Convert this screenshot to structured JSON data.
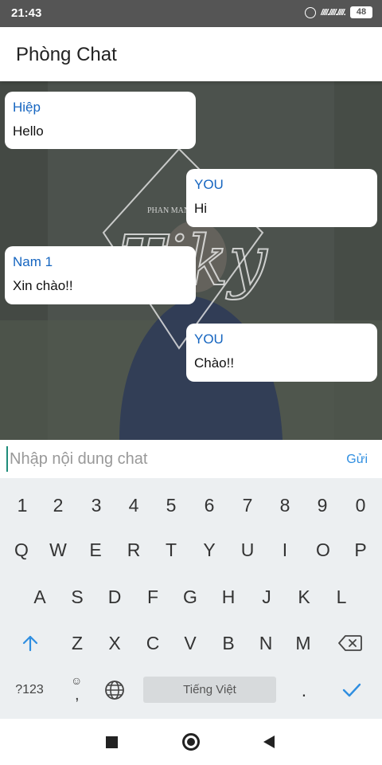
{
  "status_bar": {
    "time": "21:43",
    "signal_text": "////.////.////.",
    "battery": "48"
  },
  "app_bar": {
    "title": "Phòng Chat"
  },
  "messages": [
    {
      "sender": "Hiệp",
      "text": "Hello"
    },
    {
      "sender": "YOU",
      "text": "Hi"
    },
    {
      "sender": "Nam 1",
      "text": "Xin chào!!"
    },
    {
      "sender": "YOU",
      "text": "Chào!!"
    }
  ],
  "background_art": {
    "small_text": "PHAN MAN",
    "large_text": "Tiky"
  },
  "input": {
    "placeholder": "Nhập nội dung chat",
    "value": "",
    "send_label": "Gửi"
  },
  "keyboard": {
    "numbers": [
      "1",
      "2",
      "3",
      "4",
      "5",
      "6",
      "7",
      "8",
      "9",
      "0"
    ],
    "row1": [
      "Q",
      "W",
      "E",
      "R",
      "T",
      "Y",
      "U",
      "I",
      "O",
      "P"
    ],
    "row2": [
      "A",
      "S",
      "D",
      "F",
      "G",
      "H",
      "J",
      "K",
      "L"
    ],
    "row3": [
      "Z",
      "X",
      "C",
      "V",
      "B",
      "N",
      "M"
    ],
    "symbols_label": "?123",
    "comma": ",",
    "space_label": "Tiếng Việt",
    "period": "."
  },
  "colors": {
    "sender_name": "#1565c0",
    "send": "#2f8ee0",
    "accent_enter": "#2f8ee0",
    "shift": "#2f8ee0"
  },
  "icons": [
    "alarm-icon",
    "signal-icon",
    "battery-icon",
    "shift-icon",
    "backspace-icon",
    "emoji-icon",
    "globe-icon",
    "enter-check-icon",
    "nav-recents-icon",
    "nav-home-icon",
    "nav-back-icon"
  ]
}
